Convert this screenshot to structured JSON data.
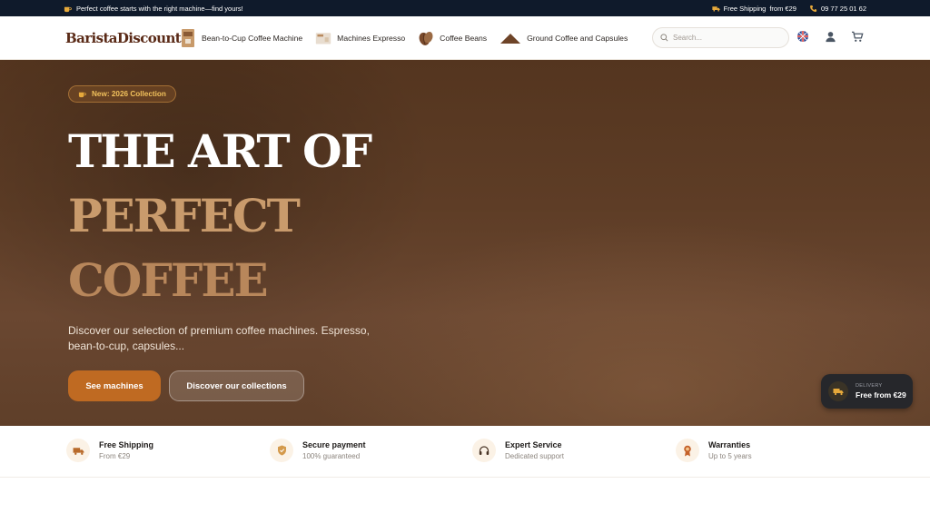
{
  "topbar": {
    "promo_text": "Perfect coffee starts with the right machine—find yours!",
    "shipping_text": "Free Shipping",
    "shipping_from": "from €29",
    "phone": "09 77 25 01 62"
  },
  "header": {
    "logo_text": "BaristaDiscount",
    "nav": [
      {
        "label": "Bean-to-Cup Coffee Machine",
        "icon": "coffee-machine-thumb"
      },
      {
        "label": "Machines Expresso",
        "icon": "espresso-machine-thumb"
      },
      {
        "label": "Coffee Beans",
        "icon": "coffee-bean-thumb"
      },
      {
        "label": "Ground Coffee and Capsules",
        "icon": "ground-coffee-thumb"
      }
    ],
    "search_placeholder": "Search...",
    "icons": [
      "uk-flag-icon",
      "user-icon",
      "cart-icon"
    ]
  },
  "hero": {
    "badge": "New: 2026 Collection",
    "title_line1": "THE ART OF",
    "title_line2": "PERFECT",
    "title_line3": "COFFEE",
    "description": "Discover our selection of premium coffee machines. Espresso, bean-to-cup, capsules...",
    "primary_button": "See machines",
    "secondary_button": "Discover our collections",
    "delivery_label": "DELIVERY",
    "delivery_value": "Free from €29"
  },
  "features": [
    {
      "title": "Free Shipping",
      "subtitle": "From €29",
      "icon": "truck-icon"
    },
    {
      "title": "Secure payment",
      "subtitle": "100% guaranteed",
      "icon": "shield-icon"
    },
    {
      "title": "Expert Service",
      "subtitle": "Dedicated support",
      "icon": "headset-icon"
    },
    {
      "title": "Warranties",
      "subtitle": "Up to 5 years",
      "icon": "award-icon"
    }
  ],
  "colors": {
    "topbar_bg": "#0f1a2b",
    "accent": "#bf6a22",
    "hero_gold": "#c99b6c",
    "badge_text": "#f1c15c"
  }
}
